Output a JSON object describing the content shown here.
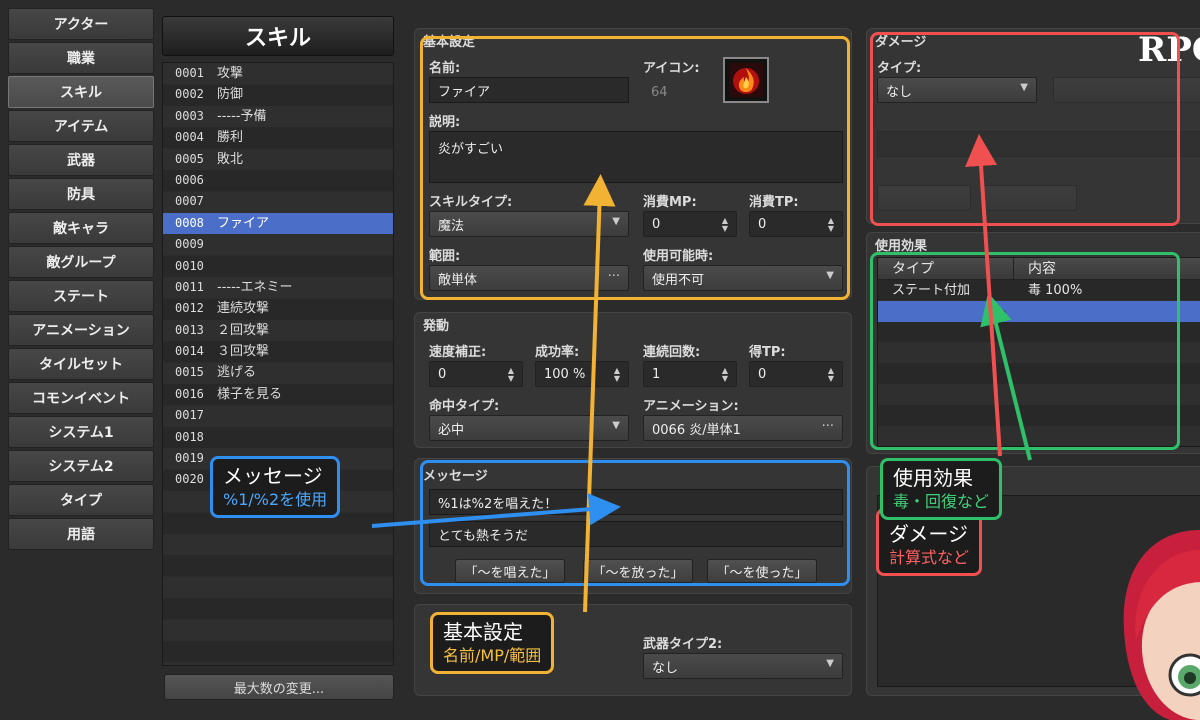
{
  "nav": [
    "アクター",
    "職業",
    "スキル",
    "アイテム",
    "武器",
    "防具",
    "敵キャラ",
    "敵グループ",
    "ステート",
    "アニメーション",
    "タイルセット",
    "コモンイベント",
    "システム1",
    "システム2",
    "タイプ",
    "用語"
  ],
  "skills": {
    "title": "スキル",
    "items": [
      {
        "id": "0001",
        "name": "攻撃"
      },
      {
        "id": "0002",
        "name": "防御"
      },
      {
        "id": "0003",
        "name": "-----予備"
      },
      {
        "id": "0004",
        "name": "勝利"
      },
      {
        "id": "0005",
        "name": "敗北"
      },
      {
        "id": "0006",
        "name": ""
      },
      {
        "id": "0007",
        "name": ""
      },
      {
        "id": "0008",
        "name": "ファイア"
      },
      {
        "id": "0009",
        "name": ""
      },
      {
        "id": "0010",
        "name": ""
      },
      {
        "id": "0011",
        "name": "-----エネミー"
      },
      {
        "id": "0012",
        "name": "連続攻撃"
      },
      {
        "id": "0013",
        "name": "２回攻撃"
      },
      {
        "id": "0014",
        "name": "３回攻撃"
      },
      {
        "id": "0015",
        "name": "逃げる"
      },
      {
        "id": "0016",
        "name": "様子を見る"
      },
      {
        "id": "0017",
        "name": ""
      },
      {
        "id": "0018",
        "name": ""
      },
      {
        "id": "0019",
        "name": ""
      },
      {
        "id": "0020",
        "name": ""
      }
    ],
    "max_button": "最大数の変更..."
  },
  "basic": {
    "title": "基本設定",
    "name_label": "名前:",
    "name": "ファイア",
    "icon_label": "アイコン:",
    "icon_index": "64",
    "desc_label": "説明:",
    "desc": "炎がすごい",
    "skill_type_label": "スキルタイプ:",
    "skill_type": "魔法",
    "mp_label": "消費MP:",
    "mp": "0",
    "tp_label": "消費TP:",
    "tp": "0",
    "scope_label": "範囲:",
    "scope": "敵単体",
    "occasion_label": "使用可能時:",
    "occasion": "使用不可"
  },
  "invocation": {
    "title": "発動",
    "speed_label": "速度補正:",
    "speed": "0",
    "success_label": "成功率:",
    "success": "100 %",
    "repeat_label": "連続回数:",
    "repeat": "1",
    "tp_gain_label": "得TP:",
    "tp_gain": "0",
    "hit_type_label": "命中タイプ:",
    "hit_type": "必中",
    "animation_label": "アニメーション:",
    "animation": "0066 炎/単体1"
  },
  "message": {
    "title": "メッセージ",
    "line1": "%1は%2を唱えた！",
    "line2": "とても熱そうだ",
    "btn1": "「～を唱えた」",
    "btn2": "「～を放った」",
    "btn3": "「～を使った」"
  },
  "required": {
    "weapon_type2_label": "武器タイプ2:",
    "weapon_type2": "なし"
  },
  "damage": {
    "title": "ダメージ",
    "type_label": "タイプ:",
    "type": "なし"
  },
  "effects": {
    "title": "使用効果",
    "col_type": "タイプ",
    "col_content": "内容",
    "rows": [
      {
        "type": "ステート付加",
        "content": "毒 100%"
      }
    ]
  },
  "logo": "RPG",
  "callouts": {
    "message": {
      "main": "メッセージ",
      "sub": "%1/%2を使用"
    },
    "basic": {
      "main": "基本設定",
      "sub": "名前/MP/範囲"
    },
    "effects": {
      "main": "使用効果",
      "sub": "毒・回復など"
    },
    "damage": {
      "main": "ダメージ",
      "sub": "計算式など"
    }
  },
  "colors": {
    "orange": "#f2b233",
    "blue": "#2f8ff0",
    "green": "#2fc06a",
    "red": "#f05050",
    "selection": "#4b6ec8"
  }
}
